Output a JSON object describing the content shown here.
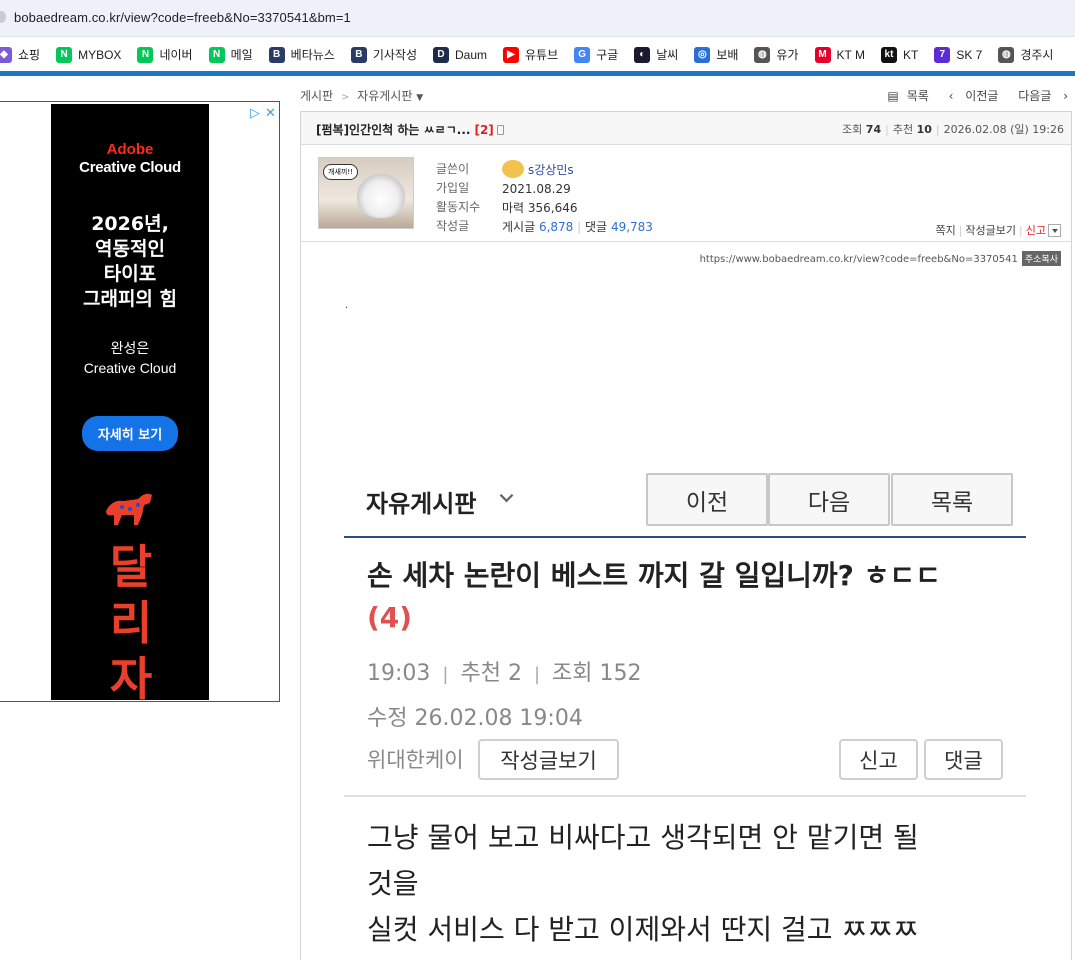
{
  "browser": {
    "url": "bobaedream.co.kr/view?code=freeb&No=3370541&bm=1",
    "bookmarks": [
      {
        "label": "쇼핑",
        "icon": "shopping-icon",
        "color": "#7b5cd6"
      },
      {
        "label": "MYBOX",
        "icon": "naver-icon",
        "color": "#03c75a"
      },
      {
        "label": "네이버",
        "icon": "naver-icon",
        "color": "#03c75a"
      },
      {
        "label": "메일",
        "icon": "naver-icon",
        "color": "#03c75a"
      },
      {
        "label": "베타뉴스",
        "icon": "bobae-icon",
        "color": "#2b3a67"
      },
      {
        "label": "기사작성",
        "icon": "bobae-icon",
        "color": "#2b3a67"
      },
      {
        "label": "Daum",
        "icon": "daum-icon",
        "color": "#1e2b4b"
      },
      {
        "label": "유튜브",
        "icon": "youtube-icon",
        "color": "#ff0000"
      },
      {
        "label": "구글",
        "icon": "google-icon",
        "color": "#4285f4"
      },
      {
        "label": "날씨",
        "icon": "weather-icon",
        "color": "#1a1a2e"
      },
      {
        "label": "보배",
        "icon": "bobae-car-icon",
        "color": "#2b6fd6"
      },
      {
        "label": "유가",
        "icon": "globe-icon",
        "color": "#555555"
      },
      {
        "label": "KT M",
        "icon": "ktm-icon",
        "color": "#e4002b"
      },
      {
        "label": "KT",
        "icon": "kt-icon",
        "color": "#111111"
      },
      {
        "label": "SK 7",
        "icon": "sk7-icon",
        "color": "#5b2bd6"
      },
      {
        "label": "경주시",
        "icon": "globe-icon",
        "color": "#555555"
      }
    ]
  },
  "ad": {
    "brand_line1": "Adobe",
    "brand_line2": "Creative Cloud",
    "headline": [
      "2026년,",
      "역동적인",
      "타이포",
      "그래피의 힘"
    ],
    "sub": [
      "완성은",
      "Creative Cloud"
    ],
    "cta": "자세히 보기",
    "big": [
      "달",
      "리",
      "자"
    ],
    "choice_icon": "ad-choices-icon",
    "close": "✕"
  },
  "nav": {
    "crumb_board": "게시판",
    "crumb_sub": "자유게시판",
    "list": "목록",
    "prev": "이전글",
    "next": "다음글"
  },
  "post": {
    "title": "[펌복]인간인척 하는 ㅆㄹㄱ...",
    "comment_count": "[2]",
    "views_label": "조회",
    "views": "74",
    "recommend_label": "추천",
    "recommend": "10",
    "date": "2026.02.08 (일) 19:26"
  },
  "author": {
    "avatar_text": "개새끼!!",
    "labels": [
      "글쓴이",
      "가입일",
      "활동지수",
      "작성글"
    ],
    "nick": "s강상민s",
    "joined": "2021.08.29",
    "activity": "마력 356,646",
    "posts_label": "게시글",
    "posts": "6,878",
    "comments_label": "댓글",
    "comments": "49,783",
    "actions": {
      "note": "쪽지",
      "view_posts": "작성글보기",
      "report": "신고"
    }
  },
  "source": {
    "url": "https://www.bobaedream.co.kr/view?code=freeb&No=3370541",
    "copy": "주소복사"
  },
  "embed": {
    "board": "자유게시판",
    "prev": "이전",
    "next": "다음",
    "list": "목록",
    "title": "손 세차 논란이 베스트 까지 갈 일입니까? ㅎㄷㄷ",
    "count": "(4)",
    "time": "19:03",
    "recommend": "추천 2",
    "views": "조회 152",
    "edited": "수정 26.02.08  19:04",
    "author": "위대한케이",
    "view_posts": "작성글보기",
    "report": "신고",
    "comment": "댓글",
    "body": [
      "그냥 물어 보고 비싸다고 생각되면 안 맡기면 될",
      "것을",
      "실컷 서비스 다 받고 이제와서 딴지 걸고  ㅉㅉㅉ"
    ]
  }
}
